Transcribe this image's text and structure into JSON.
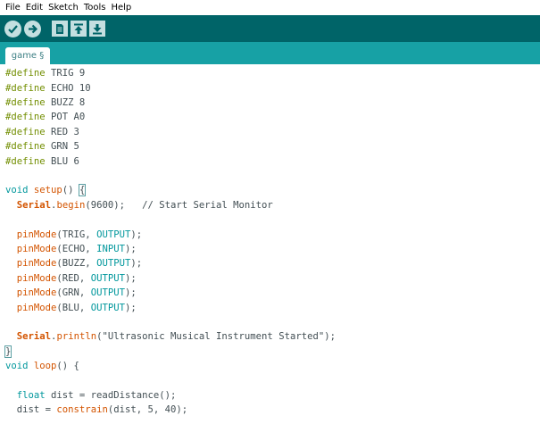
{
  "menu": [
    "File",
    "Edit",
    "Sketch",
    "Tools",
    "Help"
  ],
  "toolbar": {
    "buttons": [
      {
        "name": "verify-button",
        "icon": "checkmark-icon"
      },
      {
        "name": "upload-button",
        "icon": "arrow-right-icon"
      },
      {
        "name": "new-button",
        "icon": "document-icon"
      },
      {
        "name": "open-button",
        "icon": "arrow-up-icon"
      },
      {
        "name": "save-button",
        "icon": "arrow-down-icon"
      }
    ]
  },
  "tab": {
    "label": "game §"
  },
  "colors": {
    "toolbar": "#006468",
    "tabstrip": "#17a1a5",
    "define": "#728e00",
    "type": "#00979c",
    "function": "#d35400"
  },
  "code": {
    "l1": {
      "kw": "#define",
      "rest": " TRIG 9"
    },
    "l2": {
      "kw": "#define",
      "rest": " ECHO 10"
    },
    "l3": {
      "kw": "#define",
      "rest": " BUZZ 8"
    },
    "l4": {
      "kw": "#define",
      "rest": " POT A0"
    },
    "l5": {
      "kw": "#define",
      "rest": " RED 3"
    },
    "l6": {
      "kw": "#define",
      "rest": " GRN 5"
    },
    "l7": {
      "kw": "#define",
      "rest": " BLU 6"
    },
    "l9": {
      "kw": "void",
      "fn": "setup",
      "rest": "() ",
      "brace": "{"
    },
    "l10": {
      "obj": "Serial",
      "dot": ".",
      "fn": "begin",
      "rest": "(9600);   ",
      "comment": "// Start Serial Monitor"
    },
    "l12": {
      "fn": "pinMode",
      "a": "(TRIG, ",
      "c": "OUTPUT",
      "b": ");"
    },
    "l13": {
      "fn": "pinMode",
      "a": "(ECHO, ",
      "c": "INPUT",
      "b": ");"
    },
    "l14": {
      "fn": "pinMode",
      "a": "(BUZZ, ",
      "c": "OUTPUT",
      "b": ");"
    },
    "l15": {
      "fn": "pinMode",
      "a": "(RED, ",
      "c": "OUTPUT",
      "b": ");"
    },
    "l16": {
      "fn": "pinMode",
      "a": "(GRN, ",
      "c": "OUTPUT",
      "b": ");"
    },
    "l17": {
      "fn": "pinMode",
      "a": "(BLU, ",
      "c": "OUTPUT",
      "b": ");"
    },
    "l19": {
      "obj": "Serial",
      "dot": ".",
      "fn": "println",
      "rest": "(\"Ultrasonic Musical Instrument Started\");"
    },
    "l20": {
      "text": "}"
    },
    "l21": {
      "kw": "void",
      "fn": "loop",
      "rest": "() {"
    },
    "l23": {
      "kw": "float",
      "rest": " dist = readDistance();"
    },
    "l24": {
      "pre": "dist = ",
      "fn": "constrain",
      "rest": "(dist, 5, 40);"
    }
  }
}
